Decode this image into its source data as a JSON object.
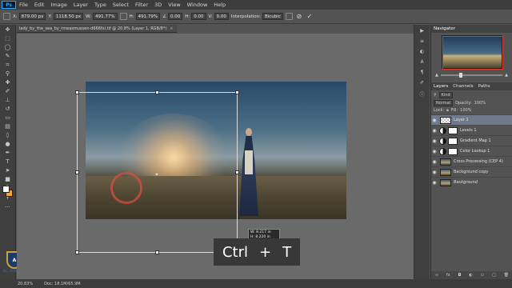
{
  "menubar": {
    "logo": "Ps",
    "items": [
      "File",
      "Edit",
      "Image",
      "Layer",
      "Type",
      "Select",
      "Filter",
      "3D",
      "View",
      "Window",
      "Help"
    ]
  },
  "options": {
    "x_label": "X:",
    "x_value": "879.00 px",
    "y_label": "Y:",
    "y_value": "1118.50 px",
    "w_label": "W:",
    "w_value": "491.77%",
    "h_label": "H:",
    "h_value": "491.79%",
    "angle_value": "0.00",
    "h_skew_value": "0.00",
    "v_skew_value": "0.00",
    "interpolation_label": "Interpolation:",
    "interpolation_value": "Bicubic"
  },
  "document": {
    "tab_title": "lady_by_the_sea_by_rmeasmussen-d666fxl.tif @ 20.8% (Layer 1, RGB/8*)",
    "tab_close": "×"
  },
  "transform_tooltip": {
    "w_text": "W: 8.217 in",
    "h_text": "H: 8.220 in"
  },
  "shortcut": {
    "key1": "Ctrl",
    "plus": "+",
    "key2": "T"
  },
  "watermark": {
    "text": "AC SCHOOL"
  },
  "navigator": {
    "title": "Navigator"
  },
  "layers_panel": {
    "tabs": [
      "Layers",
      "Channels",
      "Paths"
    ],
    "kind_label": "Kind",
    "blend_mode": "Normal",
    "opacity_label": "Opacity:",
    "opacity_value": "100%",
    "lock_label": "Lock:",
    "fill_label": "Fill:",
    "fill_value": "100%",
    "layers": [
      {
        "name": "Layer 1"
      },
      {
        "name": "Levels 1"
      },
      {
        "name": "Gradient Map 1"
      },
      {
        "name": "Color Lookup 1"
      },
      {
        "name": "Cross Processing (CEP 4)"
      },
      {
        "name": "Background copy"
      },
      {
        "name": "Background"
      }
    ]
  },
  "statusbar": {
    "zoom": "20.83%",
    "doc": "Doc: 18.1M/65.9M"
  }
}
